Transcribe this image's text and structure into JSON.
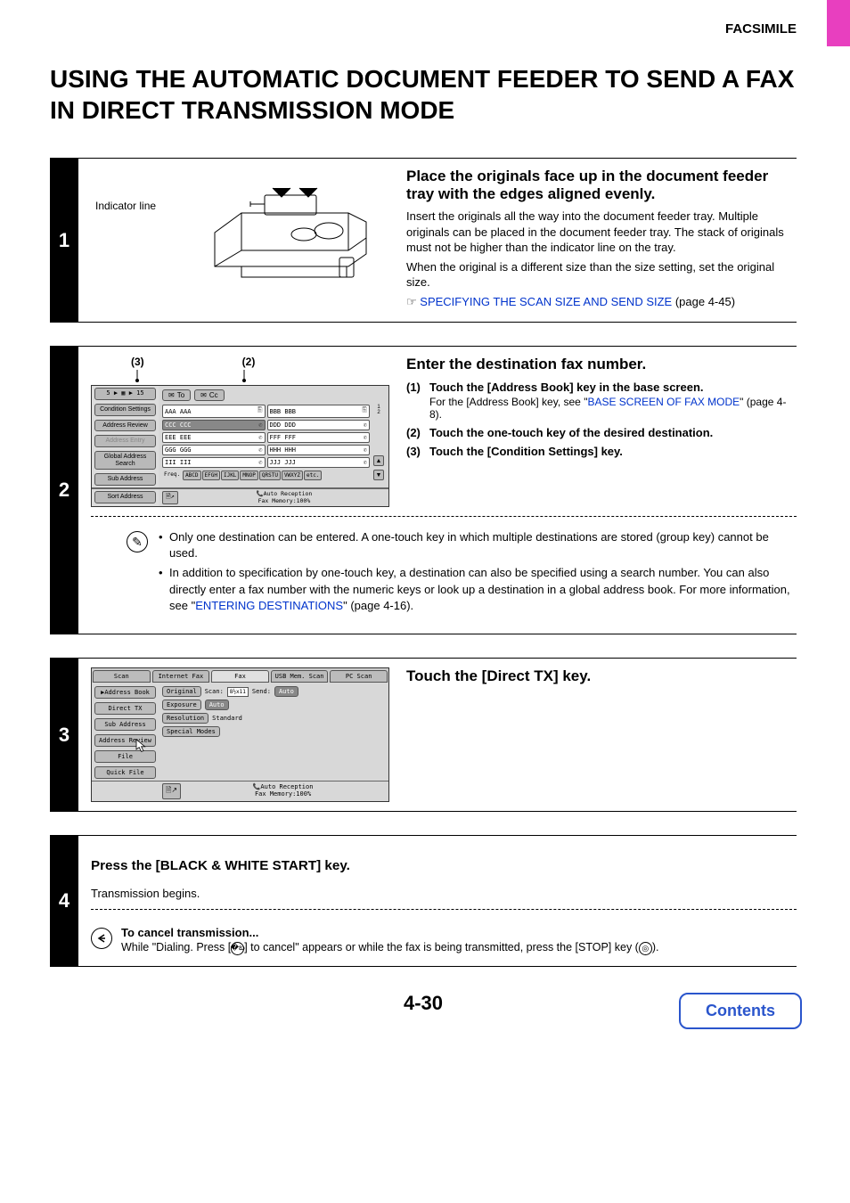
{
  "header": {
    "section_label": "FACSIMILE"
  },
  "title": "USING THE AUTOMATIC DOCUMENT FEEDER TO SEND A FAX IN DIRECT TRANSMISSION MODE",
  "page_number": "4-30",
  "contents_button": "Contents",
  "step1": {
    "num": "1",
    "indicator_label": "Indicator line",
    "heading": "Place the originals face up in the document feeder tray with the edges aligned evenly.",
    "p1": "Insert the originals all the way into the document feeder tray. Multiple originals can be placed in the document feeder tray. The stack of originals must not be higher than the indicator line on the tray.",
    "p2": "When the original is a different size than the size setting, set the original size.",
    "link_prefix": "☞ ",
    "link_text": "SPECIFYING THE SCAN SIZE AND SEND SIZE",
    "link_suffix": " (page 4-45)"
  },
  "step2": {
    "num": "2",
    "callout3": "(3)",
    "callout2": "(2)",
    "heading": "Enter the destination fax number.",
    "subs": [
      {
        "n": "(1)",
        "title": "Touch the [Address Book] key in the base screen.",
        "note_pre": "For the [Address Book] key, see \"",
        "note_link": "BASE SCREEN OF FAX MODE",
        "note_post": "\" (page 4-8)."
      },
      {
        "n": "(2)",
        "title": "Touch the one-touch key of the desired destination."
      },
      {
        "n": "(3)",
        "title": "Touch the [Condition Settings] key."
      }
    ],
    "screen": {
      "breadcrumb": "5 ▶ ▦ ▶ 15",
      "sidebar": [
        "Condition Settings",
        "Address Review",
        "Address Entry",
        "Global Address Search",
        "Sub Address"
      ],
      "to": "To",
      "cc": "Cc",
      "contacts": [
        [
          "AAA AAA",
          "BBB BBB"
        ],
        [
          "CCC CCC",
          "DDD DDD"
        ],
        [
          "EEE EEE",
          "FFF FFF"
        ],
        [
          "GGG GGG",
          "HHH HHH"
        ],
        [
          "III III",
          "JJJ JJJ"
        ]
      ],
      "pagenums": [
        "1",
        "2"
      ],
      "alpha_label": "Freq.",
      "alpha": [
        "ABCD",
        "EFGH",
        "IJKL",
        "MNOP",
        "QRSTU",
        "VWXYZ",
        "etc."
      ],
      "sort_label": "Sort Address",
      "status1": "Auto Reception",
      "status2": "Fax Memory:100%"
    },
    "notes": [
      "Only one destination can be entered. A one-touch key in which multiple destinations are stored (group key) cannot be used.",
      "In addition to specification by one-touch key, a destination can also be specified using a search number. You can also directly enter a fax number with the numeric keys or look up a destination in a global address book. For more information, see "
    ],
    "notes_link": "\"ENTERING DESTINATIONS\"",
    "notes_link_text": "ENTERING DESTINATIONS",
    "notes_suffix": " (page 4-16)."
  },
  "step3": {
    "num": "3",
    "heading": "Touch the [Direct TX] key.",
    "screen": {
      "tabs": [
        "Scan",
        "Internet Fax",
        "Fax",
        "USB Mem. Scan",
        "PC Scan"
      ],
      "active_tab": 2,
      "side": [
        "Address Book",
        "Direct TX",
        "Sub Address",
        "Address Review",
        "File",
        "Quick File"
      ],
      "lines": [
        {
          "label": "Original",
          "extra_label": "Scan:",
          "page": "8½x11",
          "send_label": "Send:",
          "send_val": "Auto"
        },
        {
          "label": "Exposure",
          "val": "Auto"
        },
        {
          "label": "Resolution",
          "val": "Standard"
        },
        {
          "label": "Special Modes"
        }
      ],
      "status1": "Auto Reception",
      "status2": "Fax Memory:100%"
    }
  },
  "step4": {
    "num": "4",
    "heading": "Press the [BLACK & WHITE START] key.",
    "sub": "Transmission begins.",
    "cancel_head": "To cancel transmission...",
    "cancel_body_pre": "While \"Dialing. Press [",
    "cancel_body_mid": "] to cancel\" appears or while the fax is being transmitted, press the [STOP] key (",
    "cancel_body_post": ")."
  }
}
